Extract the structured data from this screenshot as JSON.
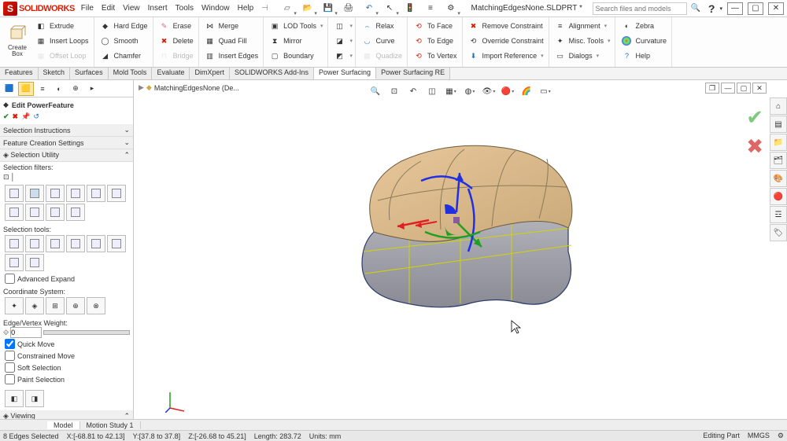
{
  "app": {
    "name": "SOLIDWORKS",
    "doc_title": "MatchingEdgesNone.SLDPRT *"
  },
  "menu": [
    "File",
    "Edit",
    "View",
    "Insert",
    "Tools",
    "Window",
    "Help"
  ],
  "search": {
    "placeholder": "Search files and models"
  },
  "ribbon": {
    "create_box": "Create\nBox",
    "g1": {
      "extrude": "Extrude",
      "insert_loops": "Insert Loops",
      "offset_loop": "Offset Loop"
    },
    "g2": {
      "hard_edge": "Hard Edge",
      "smooth": "Smooth",
      "chamfer": "Chamfer"
    },
    "g3": {
      "erase": "Erase",
      "delete": "Delete",
      "bridge": "Bridge"
    },
    "g4": {
      "merge": "Merge",
      "quad_fill": "Quad Fill",
      "insert_edges": "Insert Edges"
    },
    "g5": {
      "lod_tools": "LOD Tools",
      "mirror": "Mirror",
      "boundary": "Boundary"
    },
    "g6": {
      "a": "",
      "b": "",
      "c": ""
    },
    "g7": {
      "relax": "Relax",
      "curve": "Curve",
      "quadize": "Quadize"
    },
    "g8": {
      "to_face": "To Face",
      "to_edge": "To Edge",
      "to_vertex": "To Vertex"
    },
    "g9": {
      "remove_constraint": "Remove Constraint",
      "override_constraint": "Override Constraint",
      "import_reference": "Import Reference"
    },
    "g10": {
      "alignment": "Alignment",
      "misc_tools": "Misc. Tools",
      "dialogs": "Dialogs"
    },
    "g11": {
      "zebra": "Zebra",
      "curvature": "Curvature",
      "help": "Help"
    }
  },
  "tabs": [
    "Features",
    "Sketch",
    "Surfaces",
    "Mold Tools",
    "Evaluate",
    "DimXpert",
    "SOLIDWORKS Add-Ins",
    "Power Surfacing",
    "Power Surfacing RE"
  ],
  "active_tab": "Power Surfacing",
  "crumb": {
    "doc": "MatchingEdgesNone  (De..."
  },
  "fm": {
    "title": "Edit PowerFeature",
    "instr": "Selection Instructions",
    "fcs": "Feature Creation Settings",
    "sel_util": "Selection Utility",
    "sel_filters": "Selection filters:",
    "sel_tools": "Selection tools:",
    "adv_expand": "Advanced Expand",
    "coord": "Coordinate System:",
    "edge_weight": "Edge/Vertex Weight:",
    "weight_val": "0",
    "quick_move": "Quick Move",
    "constrained_move": "Constrained Move",
    "soft_selection": "Soft Selection",
    "paint_selection": "Paint Selection",
    "viewing": "Viewing"
  },
  "bottom_tabs": {
    "model": "Model",
    "motion": "Motion Study 1"
  },
  "status": {
    "sel": "8 Edges Selected",
    "x": "X:[-68.81 to 42.13]",
    "y": "Y:[37.8 to 37.8]",
    "z": "Z:[-26.68 to 45.21]",
    "length": "Length: 283.72",
    "units_label": "Units: mm",
    "mode": "Editing Part",
    "units": "MMGS"
  }
}
